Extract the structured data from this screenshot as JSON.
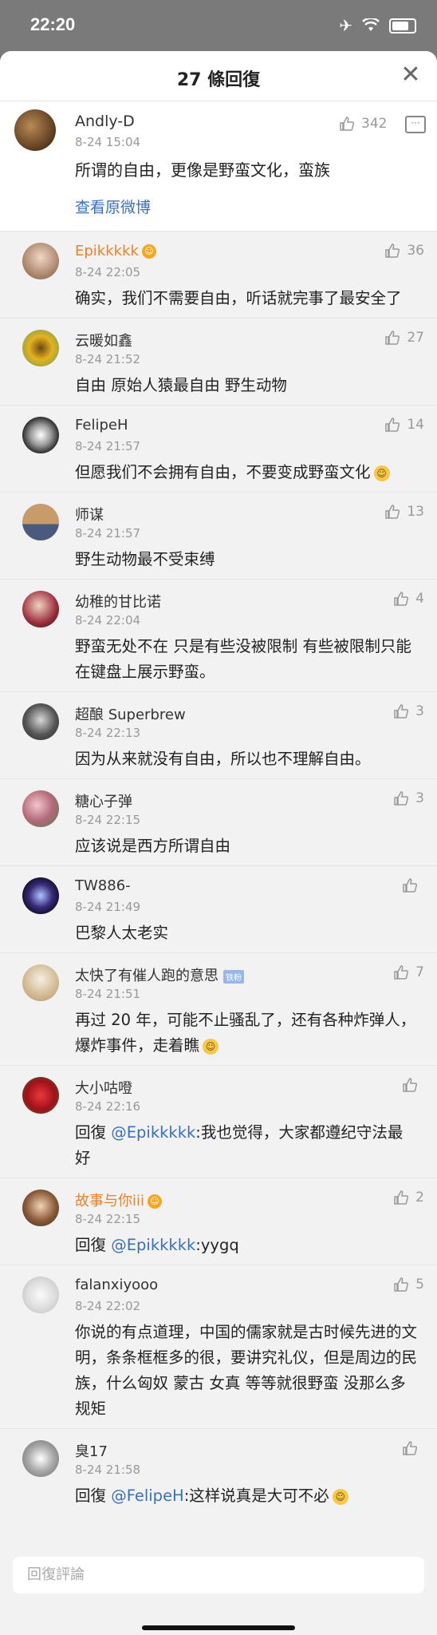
{
  "status_bar": {
    "time": "22:20"
  },
  "sheet": {
    "title": "27 條回復",
    "close_label": "✕"
  },
  "original": {
    "username": "Andly-D",
    "time": "8-24 15:04",
    "text": "所谓的自由，更像是野蛮文化，蛮族",
    "likes": "342",
    "view_original": "查看原微博"
  },
  "comments": [
    {
      "username": "Epikkkkk",
      "time": "8-24 22:05",
      "likes": "36",
      "text": "确实，我们不需要自由，听话就完事了最安全了"
    },
    {
      "username": "云暖如鑫",
      "time": "8-24 21:52",
      "likes": "27",
      "text": "自由 原始人猿最自由 野生动物"
    },
    {
      "username": "FelipeH",
      "time": "8-24 21:57",
      "likes": "14",
      "text": "但愿我们不会拥有自由，不要变成野蛮文化"
    },
    {
      "username": "师谋",
      "time": "8-24 21:57",
      "likes": "13",
      "text": "野生动物最不受束缚"
    },
    {
      "username": "幼稚的甘比诺",
      "time": "8-24 22:04",
      "likes": "4",
      "text": "野蛮无处不在 只是有些没被限制 有些被限制只能在键盘上展示野蛮。"
    },
    {
      "username": "超酿 Superbrew",
      "time": "8-24 22:13",
      "likes": "3",
      "text": "因为从来就没有自由，所以也不理解自由。"
    },
    {
      "username": "糖心子弹",
      "time": "8-24 22:15",
      "likes": "3",
      "text": "应该说是西方所谓自由"
    },
    {
      "username": "TW886-",
      "time": "8-24 21:49",
      "likes": "",
      "text": "巴黎人太老实"
    },
    {
      "username": "太快了有催人跑的意思",
      "badge": "铁粉",
      "time": "8-24 21:51",
      "likes": "7",
      "text": "再过 20 年，可能不止骚乱了，还有各种炸弹人，爆炸事件，走着瞧"
    },
    {
      "username": "大小咕噔",
      "time": "8-24 22:16",
      "likes": "",
      "reply_prefix": "回復 ",
      "mention": "@Epikkkkk",
      "text": ":我也觉得，大家都遵纪守法最好"
    },
    {
      "username": "故事与你iii",
      "time": "8-24 22:15",
      "likes": "2",
      "reply_prefix": "回復 ",
      "mention": "@Epikkkkk",
      "text": ":yygq"
    },
    {
      "username": "falanxiyooo",
      "time": "8-24 22:02",
      "likes": "5",
      "text": "你说的有点道理，中国的儒家就是古时候先进的文明，条条框框多的很，要讲究礼仪，但是周边的民族，什么匈奴 蒙古 女真 等等就很野蛮 没那么多规矩"
    },
    {
      "username": "臭17",
      "time": "8-24 21:58",
      "likes": "",
      "reply_prefix": "回復 ",
      "mention": "@FelipeH",
      "text": ":这样说真是大可不必"
    }
  ],
  "composer": {
    "placeholder": "回復評論"
  },
  "colors": {
    "link": "#3a6fbf",
    "vip_name": "#e8822e",
    "meta": "#999999"
  },
  "icons": [
    "airplane-icon",
    "wifi-icon",
    "battery-icon",
    "close-icon",
    "thumbs-up-icon",
    "comment-icon"
  ]
}
